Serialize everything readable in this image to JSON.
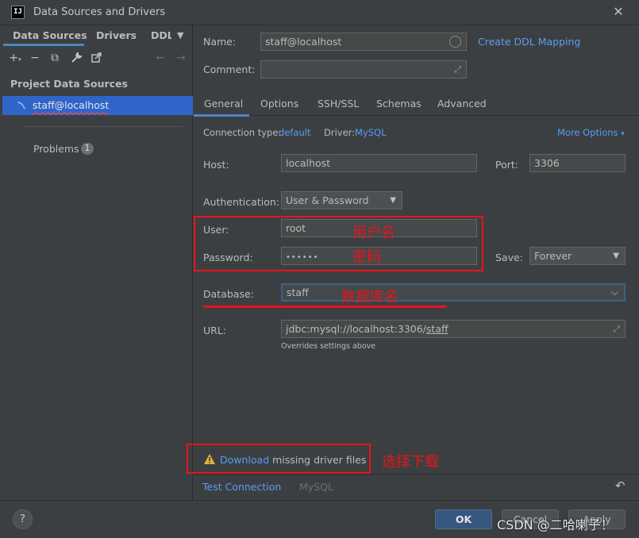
{
  "window": {
    "title": "Data Sources and Drivers",
    "logo": "IJ"
  },
  "left": {
    "tabs": [
      "Data Sources",
      "Drivers",
      "DDL"
    ],
    "section_title": "Project Data Sources",
    "datasource": "staff@localhost",
    "problems_label": "Problems",
    "problems_count": "1"
  },
  "name_row": {
    "label": "Name:",
    "value": "staff@localhost",
    "ddl_link": "Create DDL Mapping"
  },
  "comment_row": {
    "label": "Comment:",
    "value": ""
  },
  "tabs": [
    "General",
    "Options",
    "SSH/SSL",
    "Schemas",
    "Advanced"
  ],
  "general": {
    "conn_type_label": "Connection type:",
    "conn_type_value": "default",
    "driver_label": "Driver:",
    "driver_value": "MySQL",
    "more_options": "More Options",
    "host_label": "Host:",
    "host_value": "localhost",
    "port_label": "Port:",
    "port_value": "3306",
    "auth_label": "Authentication:",
    "auth_value": "User & Password",
    "user_label": "User:",
    "user_value": "root",
    "password_label": "Password:",
    "password_value": "••••••",
    "save_label": "Save:",
    "save_value": "Forever",
    "database_label": "Database:",
    "database_value": "staff",
    "url_label": "URL:",
    "url_prefix": "jdbc:mysql://localhost:3306/",
    "url_db": "staff",
    "url_hint": "Overrides settings above"
  },
  "warning": {
    "link": "Download",
    "text": " missing driver files"
  },
  "bottom": {
    "test_connection": "Test Connection",
    "mysql": "MySQL"
  },
  "annotations": {
    "username": "用户名",
    "password": "密码",
    "database": "数据库名",
    "download": "选择下载"
  },
  "buttons": {
    "ok": "OK",
    "cancel": "Cancel",
    "apply": "Apply"
  },
  "watermark": "CSDN @二哈喇子！",
  "colors": {
    "accent": "#589df6",
    "selection": "#2f65ca",
    "annotation": "#e8141c"
  }
}
